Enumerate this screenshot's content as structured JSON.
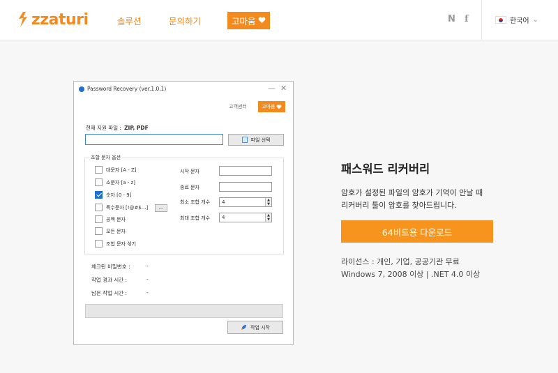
{
  "header": {
    "logo_text": "zzaturi",
    "nav": {
      "solution": "솔루션",
      "inquiry": "문의하기",
      "thanks": "고마움"
    },
    "social": {
      "naver": "N",
      "facebook": "f"
    },
    "language": "한국어"
  },
  "window": {
    "title": "Password Recovery (ver.1.0.1)",
    "help_center": "고객센터",
    "thanks": "고마움",
    "supported_label": "현재 지원 파일 :",
    "supported_formats": "ZIP, PDF",
    "path_value": "",
    "file_select": "파일 선택",
    "group_label": "조합 문자 옵션",
    "checkboxes": [
      {
        "label": "대문자 [A - Z]",
        "checked": false
      },
      {
        "label": "소문자 [a - z]",
        "checked": false
      },
      {
        "label": "숫자 [0 - 9]",
        "checked": true
      },
      {
        "label": "특수문자 [!@#$...]",
        "checked": false
      },
      {
        "label": "공백 문자",
        "checked": false
      },
      {
        "label": "모든 문자",
        "checked": false
      },
      {
        "label": "조합 문자 섞기",
        "checked": false
      }
    ],
    "special_chars_button": "...",
    "params": {
      "start_char_label": "시작 문자",
      "start_char_value": "",
      "end_char_label": "종료 문자",
      "end_char_value": "",
      "min_len_label": "최소 조합 개수",
      "min_len_value": "4",
      "max_len_label": "최대 조합 개수",
      "max_len_value": "4"
    },
    "stats": {
      "checked_label": "체크된 비밀번호 :",
      "checked_value": "-",
      "elapsed_label": "작업 경과 시간 :",
      "elapsed_value": "-",
      "remaining_label": "남은 작업 시간 :",
      "remaining_value": "-"
    },
    "progress": 0,
    "start_button": "작업 시작"
  },
  "product": {
    "title": "패스워드 리커버리",
    "desc_line1": "암호가 설정된 파일의 암호가 기억이 안날 때",
    "desc_line2": "리커버리 툴이 암호를 찾아드립니다.",
    "download_button": "64비트용 다운로드",
    "license_line1": "라이선스 : 개인, 기업, 공공기관 무료",
    "license_line2": "Windows 7, 2008 이상 | .NET 4.0 이상"
  },
  "colors": {
    "accent": "#f28a1e",
    "download": "#f7941e",
    "checkbox_checked": "#1e6fd0"
  }
}
